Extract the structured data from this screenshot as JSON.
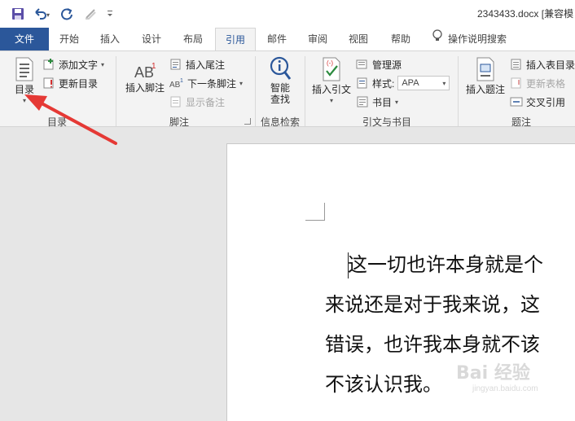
{
  "title_bar": {
    "document_title": "2343433.docx [兼容模",
    "qat": [
      "save-icon",
      "undo-icon",
      "redo-icon",
      "format-painter-icon",
      "customize-icon"
    ]
  },
  "tabs": [
    {
      "label": "文件"
    },
    {
      "label": "开始"
    },
    {
      "label": "插入"
    },
    {
      "label": "设计"
    },
    {
      "label": "布局"
    },
    {
      "label": "引用",
      "active": true
    },
    {
      "label": "邮件"
    },
    {
      "label": "审阅"
    },
    {
      "label": "视图"
    },
    {
      "label": "帮助"
    },
    {
      "label": "操作说明搜索"
    }
  ],
  "ribbon": {
    "toc": {
      "big_label": "目录",
      "add_text": "添加文字",
      "update_toc": "更新目录",
      "group_label": "目录"
    },
    "footnotes": {
      "insert_footnote": "插入脚注",
      "insert_endnote": "插入尾注",
      "next_footnote": "下一条脚注",
      "show_notes": "显示备注",
      "group_label": "脚注"
    },
    "research": {
      "smart_lookup_line1": "智能",
      "smart_lookup_line2": "查找",
      "group_label": "信息检索"
    },
    "citations": {
      "insert_citation": "插入引文",
      "manage_sources": "管理源",
      "style_label": "样式:",
      "style_value": "APA",
      "bibliography": "书目",
      "group_label": "引文与书目"
    },
    "captions": {
      "insert_caption": "插入题注",
      "insert_table_of_figures": "插入表目录",
      "update_table": "更新表格",
      "cross_reference": "交叉引用",
      "group_label": "题注"
    }
  },
  "document": {
    "lines": [
      "这一切也许本身就是个",
      "来说还是对于我来说，这",
      "错误，也许我本身就不该",
      "不该认识我。"
    ]
  },
  "watermark": {
    "text": "Bai 经验",
    "sub": "jingyan.baidu.com"
  },
  "colors": {
    "file_tab": "#2b579a",
    "accent": "#2b579a",
    "arrow": "#e53935"
  }
}
